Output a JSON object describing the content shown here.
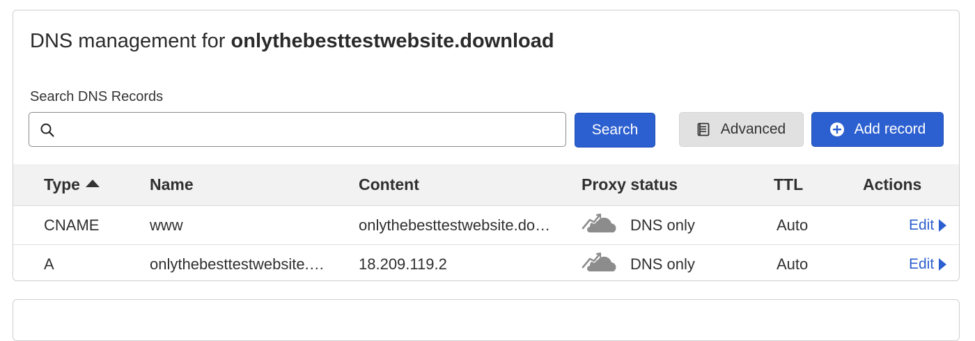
{
  "header": {
    "title_prefix": "DNS management for",
    "domain": "onlythebesttestwebsite.download"
  },
  "search": {
    "label": "Search DNS Records",
    "value": "",
    "placeholder": "",
    "button_label": "Search"
  },
  "toolbar": {
    "advanced_label": "Advanced",
    "add_record_label": "Add record"
  },
  "table": {
    "columns": [
      "Type",
      "Name",
      "Content",
      "Proxy status",
      "TTL",
      "Actions"
    ],
    "sort": {
      "column": "Type",
      "direction": "ascending"
    },
    "rows": [
      {
        "type": "CNAME",
        "name": "www",
        "content": "onlythebesttestwebsite.do…",
        "proxy_status": "DNS only",
        "ttl": "Auto",
        "action": "Edit"
      },
      {
        "type": "A",
        "name": "onlythebesttestwebsite.…",
        "content": "18.209.119.2",
        "proxy_status": "DNS only",
        "ttl": "Auto",
        "action": "Edit"
      }
    ]
  },
  "colors": {
    "accent": "#2c5fcf",
    "header_bg": "#f2f2f2",
    "secondary_button": "#e1e1e1",
    "cloud_gray": "#8c8c8c"
  },
  "icons": {
    "search": "search-icon",
    "advanced": "document-icon",
    "add": "plus-circle-icon",
    "proxy": "cloud-dns-only-icon",
    "sort": "sort-up-icon",
    "edit": "caret-right-icon"
  }
}
